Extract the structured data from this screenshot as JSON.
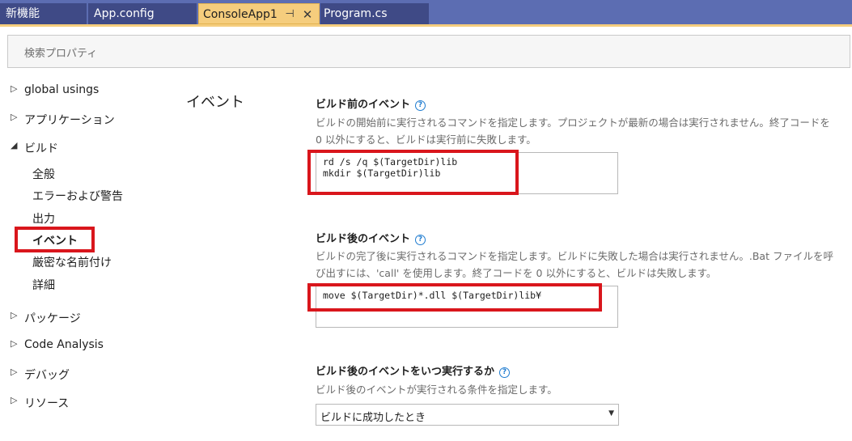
{
  "tabs": [
    {
      "label": "新機能",
      "active": false
    },
    {
      "label": "App.config",
      "active": false
    },
    {
      "label": "ConsoleApp1",
      "active": true,
      "pin_icon": "pin-icon",
      "close_icon": "close-icon"
    },
    {
      "label": "Program.cs",
      "active": false
    }
  ],
  "search": {
    "placeholder": "検索プロパティ"
  },
  "nav": {
    "items": [
      {
        "label": "global usings",
        "expanded": false
      },
      {
        "label": "アプリケーション",
        "expanded": false
      },
      {
        "label": "ビルド",
        "expanded": true
      },
      {
        "label": "パッケージ",
        "expanded": false
      },
      {
        "label": "Code Analysis",
        "expanded": false
      },
      {
        "label": "デバッグ",
        "expanded": false
      },
      {
        "label": "リソース",
        "expanded": false
      }
    ],
    "build_children": [
      "全般",
      "エラーおよび警告",
      "出力",
      "イベント",
      "厳密な名前付け",
      "詳細"
    ],
    "selected": "イベント"
  },
  "main": {
    "section_title": "イベント",
    "pre_build": {
      "title": "ビルド前のイベント",
      "description": "ビルドの開始前に実行されるコマンドを指定します。プロジェクトが最新の場合は実行されません。終了コードを 0 以外にすると、ビルドは実行前に失敗します。",
      "command": "rd /s /q $(TargetDir)lib\nmkdir $(TargetDir)lib"
    },
    "post_build": {
      "title": "ビルド後のイベント",
      "description": "ビルドの完了後に実行されるコマンドを指定します。ビルドに失敗した場合は実行されません。.Bat ファイルを呼び出すには、'call' を使用します。終了コードを 0 以外にすると、ビルドは失敗します。",
      "command": "move $(TargetDir)*.dll $(TargetDir)lib¥"
    },
    "run_post_build": {
      "title": "ビルド後のイベントをいつ実行するか",
      "description": "ビルド後のイベントが実行される条件を指定します。",
      "selected": "ビルドに成功したとき"
    }
  },
  "colors": {
    "accent": "#f5cd7d",
    "tab_strip": "#5c6db2",
    "highlight": "#d9161c"
  }
}
